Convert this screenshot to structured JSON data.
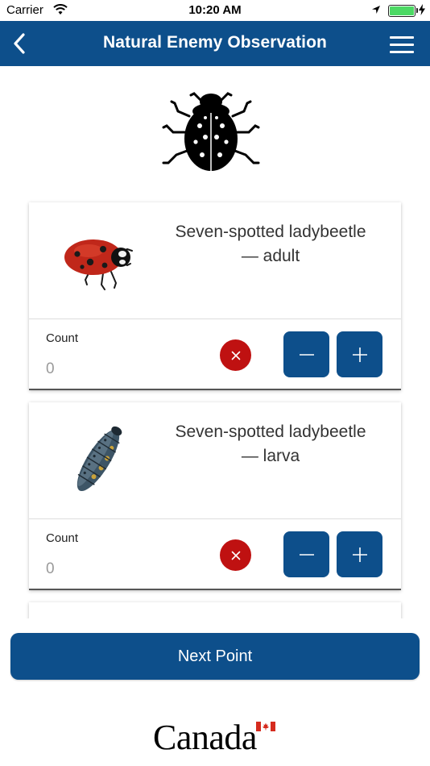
{
  "status_bar": {
    "carrier": "Carrier",
    "time": "10:20 AM",
    "battery_level": 1.0
  },
  "nav": {
    "title": "Natural Enemy Observation"
  },
  "items": [
    {
      "name_line1": "Seven-spotted ladybeetle",
      "name_line2": "— adult",
      "count_label": "Count",
      "count_value": "0"
    },
    {
      "name_line1": "Seven-spotted ladybeetle",
      "name_line2": "— larva",
      "count_label": "Count",
      "count_value": "0"
    }
  ],
  "next_button": {
    "label": "Next Point"
  },
  "footer": {
    "wordmark": "Canada"
  },
  "colors": {
    "primary": "#0d4f8b",
    "danger": "#bf1111",
    "battery": "#4cd964"
  }
}
